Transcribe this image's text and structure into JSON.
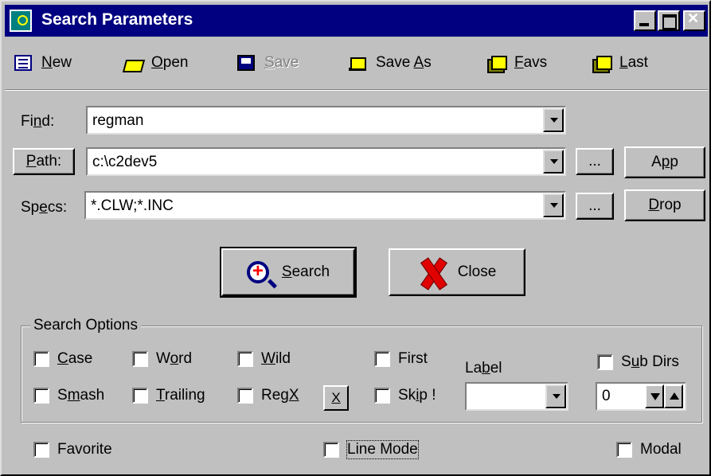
{
  "window": {
    "title": "Search Parameters"
  },
  "toolbar": [
    {
      "label": "New",
      "mnemonic": "N",
      "rest": "ew",
      "icon": "new-document-icon",
      "enabled": true
    },
    {
      "label": "Open",
      "mnemonic": "O",
      "rest": "pen",
      "icon": "open-folder-icon",
      "enabled": true
    },
    {
      "label": "Save",
      "mnemonic": "S",
      "rest": "ave",
      "icon": "floppy-disk-icon",
      "enabled": false
    },
    {
      "label": "Save As",
      "pre": "Save ",
      "mnemonic": "A",
      "rest": "s",
      "icon": "save-as-icon",
      "enabled": true
    },
    {
      "label": "Favs",
      "mnemonic": "F",
      "rest": "avs",
      "icon": "favorites-folders-icon",
      "enabled": true
    },
    {
      "label": "Last",
      "mnemonic": "L",
      "rest": "ast",
      "icon": "last-folders-icon",
      "enabled": true
    }
  ],
  "form": {
    "find": {
      "pre": "Fi",
      "mnemonic": "n",
      "rest": "d:",
      "value": "regman"
    },
    "path": {
      "pre": "",
      "mnemonic": "P",
      "rest": "ath:",
      "value": "c:\\c2dev5",
      "browse_label": "..."
    },
    "specs": {
      "pre": "Sp",
      "mnemonic": "e",
      "rest": "cs:",
      "value": "*.CLW;*.INC",
      "browse_label": "..."
    },
    "app_button": {
      "pre": "A",
      "mnemonic": "p",
      "rest": "p"
    },
    "drop_button": {
      "pre": "",
      "mnemonic": "D",
      "rest": "rop"
    }
  },
  "actions": {
    "search": {
      "pre": "",
      "mnemonic": "S",
      "rest": "earch"
    },
    "close": {
      "label": "Close"
    }
  },
  "search_options": {
    "title": "Search Options",
    "case": {
      "pre": "",
      "mnemonic": "C",
      "rest": "ase",
      "checked": false
    },
    "word": {
      "pre": "W",
      "mnemonic": "o",
      "rest": "rd",
      "checked": false
    },
    "wild": {
      "pre": "",
      "mnemonic": "W",
      "rest": "ild",
      "checked": false
    },
    "first": {
      "label": "First",
      "checked": false
    },
    "smash": {
      "pre": "S",
      "mnemonic": "m",
      "rest": "ash",
      "checked": false
    },
    "trailing": {
      "pre": "",
      "mnemonic": "T",
      "rest": "railing",
      "checked": false
    },
    "regx": {
      "pre": "Reg",
      "mnemonic": "X",
      "rest": "",
      "button": "X",
      "checked": false
    },
    "skip": {
      "pre": "Sk",
      "mnemonic": "i",
      "rest": "p !",
      "checked": false
    },
    "label": {
      "pre": "La",
      "mnemonic": "b",
      "rest": "el",
      "value": ""
    },
    "subdirs": {
      "pre": "S",
      "mnemonic": "u",
      "rest": "b Dirs",
      "checked": false
    },
    "depth": {
      "value": "0"
    }
  },
  "footer": {
    "favorite": {
      "label": "Favorite",
      "checked": false
    },
    "line_mode": {
      "label": "Line Mode",
      "checked": false
    },
    "modal": {
      "label": "Modal",
      "checked": false
    }
  }
}
